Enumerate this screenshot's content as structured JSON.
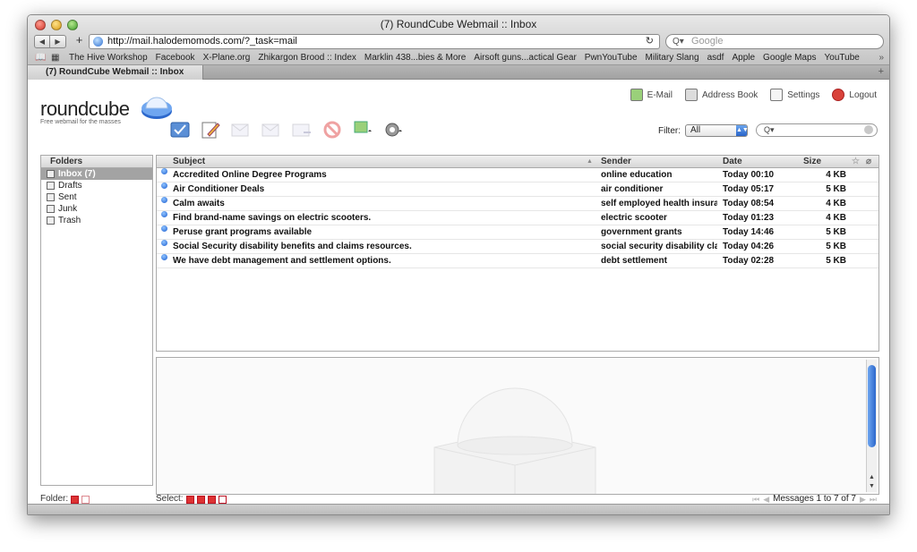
{
  "window": {
    "title": "(7) RoundCube Webmail :: Inbox"
  },
  "browser": {
    "url": "http://mail.halodemomods.com/?_task=mail",
    "search_placeholder": "Google",
    "bookmarks": [
      "The Hive Workshop",
      "Facebook",
      "X-Plane.org",
      "Zhikargon Brood :: Index",
      "Marklin 438...bies & More",
      "Airsoft guns...actical Gear",
      "PwnYouTube",
      "Military Slang",
      "asdf",
      "Apple",
      "Google Maps",
      "YouTube"
    ],
    "more": "»",
    "tab_label": "(7) RoundCube Webmail :: Inbox",
    "tab_add": "+"
  },
  "logo": {
    "name": "roundcube",
    "tagline": "Free webmail for the masses"
  },
  "topnav": {
    "email": "E-Mail",
    "address_book": "Address Book",
    "settings": "Settings",
    "logout": "Logout"
  },
  "filter": {
    "label": "Filter:",
    "value": "All",
    "search_prefix": "Q▾"
  },
  "folders": {
    "header": "Folders",
    "items": [
      {
        "label": "Inbox (7)",
        "selected": true,
        "icon": "inbox-icon"
      },
      {
        "label": "Drafts",
        "selected": false,
        "icon": "drafts-icon"
      },
      {
        "label": "Sent",
        "selected": false,
        "icon": "sent-icon"
      },
      {
        "label": "Junk",
        "selected": false,
        "icon": "junk-icon"
      },
      {
        "label": "Trash",
        "selected": false,
        "icon": "trash-icon"
      }
    ]
  },
  "messages": {
    "columns": {
      "subject": "Subject",
      "sender": "Sender",
      "date": "Date",
      "size": "Size"
    },
    "rows": [
      {
        "subject": "Accredited Online Degree Programs",
        "sender": "online education",
        "date": "Today 00:10",
        "size": "4 KB"
      },
      {
        "subject": "Air Conditioner Deals",
        "sender": "air conditioner",
        "date": "Today 05:17",
        "size": "5 KB"
      },
      {
        "subject": "Calm awaits",
        "sender": "self employed health insura...",
        "date": "Today 08:54",
        "size": "4 KB"
      },
      {
        "subject": "Find brand-name savings on electric scooters.",
        "sender": "electric scooter",
        "date": "Today 01:23",
        "size": "4 KB"
      },
      {
        "subject": "Peruse grant programs available",
        "sender": "government grants",
        "date": "Today 14:46",
        "size": "5 KB"
      },
      {
        "subject": "Social Security disability benefits and claims resources.",
        "sender": "social security disability cla...",
        "date": "Today 04:26",
        "size": "5 KB"
      },
      {
        "subject": "We have debt management and settlement options.",
        "sender": "debt settlement",
        "date": "Today 02:28",
        "size": "5 KB"
      }
    ]
  },
  "status": {
    "folder_label": "Folder:",
    "select_label": "Select:",
    "pages": "Messages 1 to 7 of 7"
  },
  "colors": {
    "selected_folder": "#a3a3a3",
    "unread_dot": "#1d5fd0",
    "brand_blue": "#2c68cc"
  }
}
